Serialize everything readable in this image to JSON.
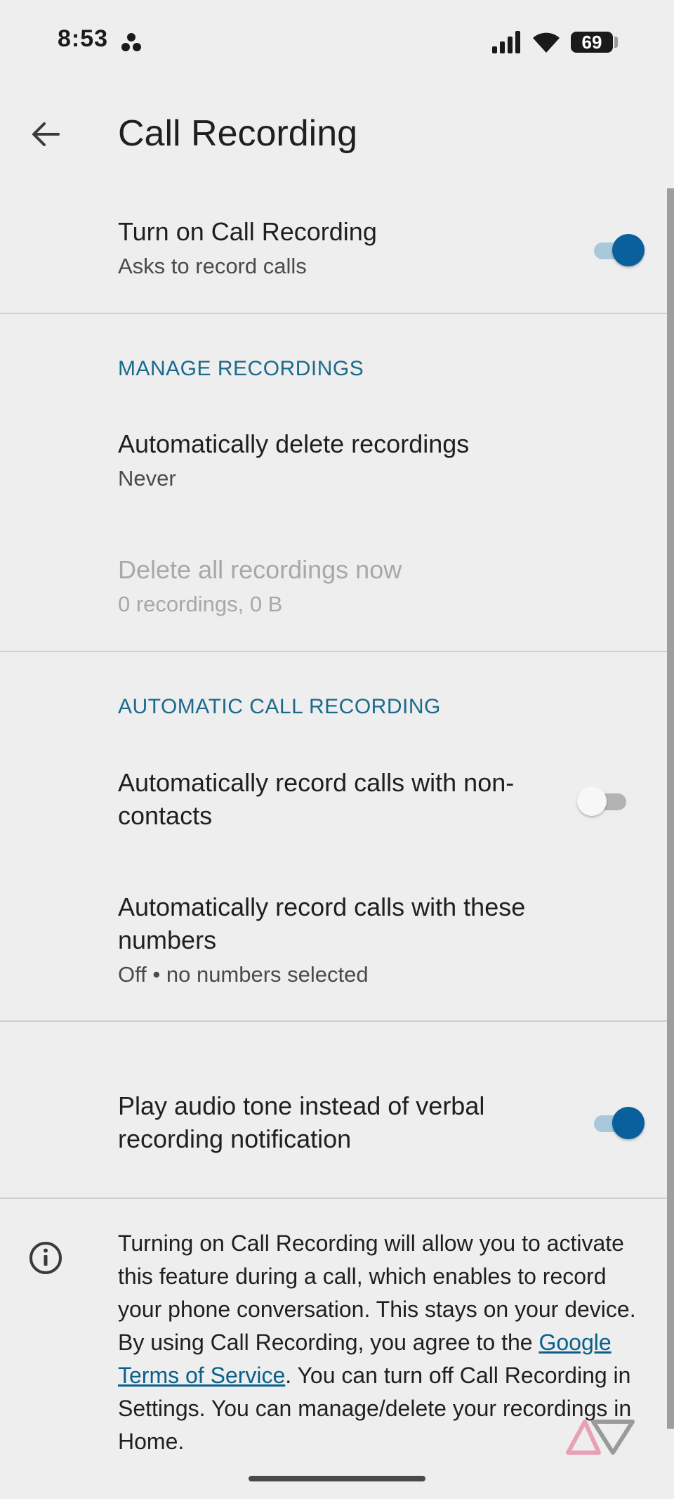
{
  "status_bar": {
    "time": "8:53",
    "battery": "69"
  },
  "app_bar": {
    "title": "Call Recording"
  },
  "main_toggle": {
    "title": "Turn on Call Recording",
    "subtitle": "Asks to record calls",
    "on": true
  },
  "manage_section": {
    "header": "MANAGE RECORDINGS",
    "auto_delete": {
      "title": "Automatically delete recordings",
      "subtitle": "Never"
    },
    "delete_all": {
      "title": "Delete all recordings now",
      "subtitle": "0 recordings, 0 B",
      "disabled": true
    }
  },
  "auto_section": {
    "header": "AUTOMATIC CALL RECORDING",
    "non_contacts": {
      "title": "Automatically record calls with non-contacts",
      "on": false
    },
    "these_numbers": {
      "title": "Automatically record calls with these numbers",
      "subtitle": "Off • no numbers selected"
    }
  },
  "audio_tone": {
    "title": "Play audio tone instead of verbal recording notification",
    "on": true
  },
  "info": {
    "text_before": "Turning on Call Recording will allow you to activate this feature during a call, which enables to record your phone conversation. This stays on your device. By using Call Recording, you agree to the ",
    "link": "Google Terms of Service",
    "text_after": ". You can turn off Call Recording in Settings. You can manage/delete your recordings in Home."
  },
  "colors": {
    "accent": "#0a5f9d",
    "section_header": "#1b6a8c",
    "background": "#eeeeee"
  },
  "icons": {
    "back": "arrow-back-icon",
    "info": "info-icon",
    "signal": "signal-icon",
    "wifi": "wifi-icon",
    "battery": "battery-icon",
    "notification": "dots-icon"
  }
}
